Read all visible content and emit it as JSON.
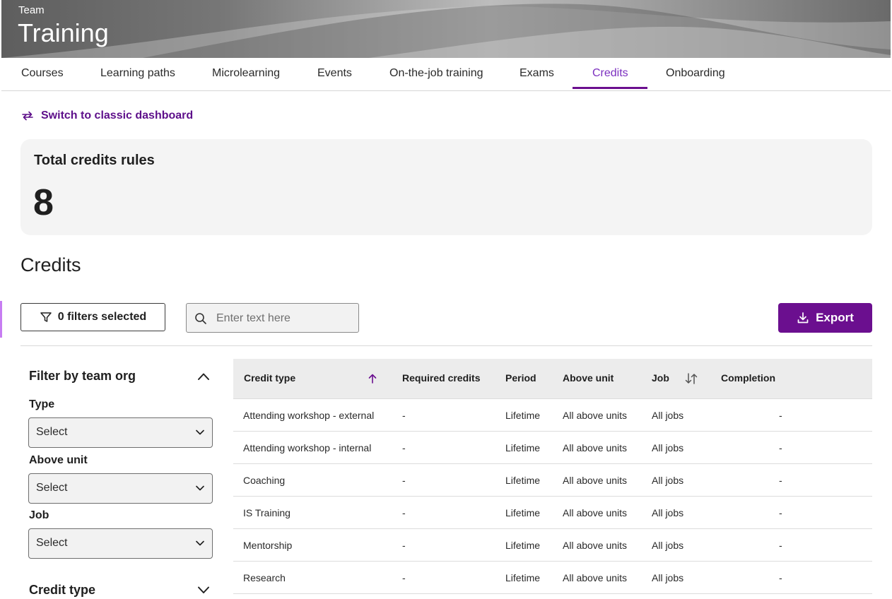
{
  "header": {
    "eyebrow": "Team",
    "title": "Training"
  },
  "tabs": [
    {
      "label": "Courses",
      "active": false
    },
    {
      "label": "Learning paths",
      "active": false
    },
    {
      "label": "Microlearning",
      "active": false
    },
    {
      "label": "Events",
      "active": false
    },
    {
      "label": "On-the-job training",
      "active": false
    },
    {
      "label": "Exams",
      "active": false
    },
    {
      "label": "Credits",
      "active": true
    },
    {
      "label": "Onboarding",
      "active": false
    }
  ],
  "switch_link": {
    "label": "Switch to classic dashboard",
    "icon": "swap-arrows-icon"
  },
  "summary": {
    "title": "Total credits rules",
    "value": "8"
  },
  "section_title": "Credits",
  "toolbar": {
    "filters_label": "0 filters selected",
    "search_placeholder": "Enter text here",
    "export_label": "Export"
  },
  "filter_panel": {
    "heading": "Filter by team org",
    "fields": [
      {
        "label": "Type",
        "value": "Select"
      },
      {
        "label": "Above unit",
        "value": "Select"
      },
      {
        "label": "Job",
        "value": "Select"
      }
    ],
    "collapsed_heading": "Credit type"
  },
  "table": {
    "columns": [
      "Credit type",
      "Required credits",
      "Period",
      "Above unit",
      "Job",
      "Completion"
    ],
    "sort": {
      "column": "Credit type",
      "direction": "ascending"
    },
    "rows": [
      [
        "Attending workshop - external",
        "-",
        "Lifetime",
        "All above units",
        "All jobs",
        "-"
      ],
      [
        "Attending workshop - internal",
        "-",
        "Lifetime",
        "All above units",
        "All jobs",
        "-"
      ],
      [
        "Coaching",
        "-",
        "Lifetime",
        "All above units",
        "All jobs",
        "-"
      ],
      [
        "IS Training",
        "-",
        "Lifetime",
        "All above units",
        "All jobs",
        "-"
      ],
      [
        "Mentorship",
        "-",
        "Lifetime",
        "All above units",
        "All jobs",
        "-"
      ],
      [
        "Research",
        "-",
        "Lifetime",
        "All above units",
        "All jobs",
        "-"
      ]
    ]
  },
  "colors": {
    "accent": "#6b0f8f",
    "active_tab_text": "#7b2fbf",
    "card_bg": "#f4f4f4"
  }
}
